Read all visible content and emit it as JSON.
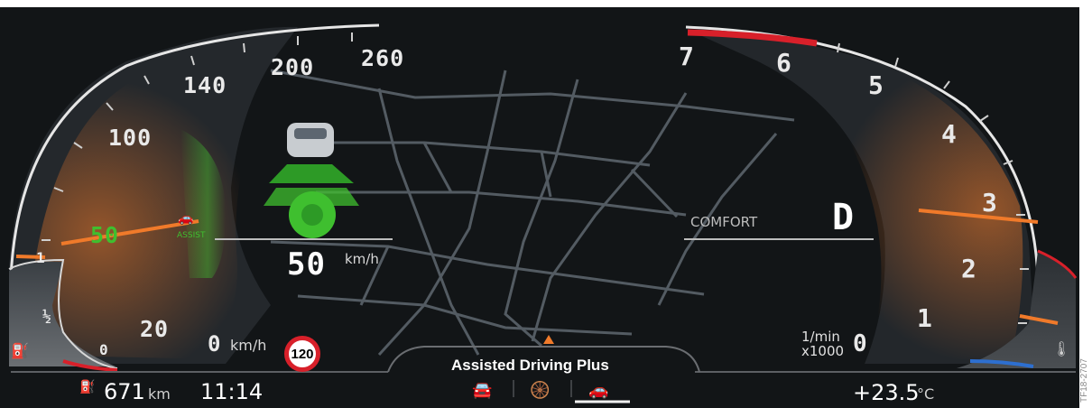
{
  "speedometer": {
    "scale_labels": [
      "20",
      "100",
      "140",
      "200",
      "260"
    ],
    "highlighted_speed": "50",
    "zero_label": "0",
    "zero_unit": "km/h",
    "current_speed_value": "50",
    "current_speed_unit": "km/h",
    "assist_label": "ASSIST"
  },
  "fuel_gauge": {
    "labels": [
      "1",
      "½",
      "0"
    ],
    "range_value": "671",
    "range_unit": "km"
  },
  "clock": "11:14",
  "speed_limit_sign": "120",
  "tachometer": {
    "scale_labels": [
      "1",
      "2",
      "3",
      "4",
      "5",
      "6",
      "7"
    ],
    "zero_label": "0",
    "unit_top": "1/min",
    "unit_bottom": "x1000"
  },
  "drive": {
    "mode": "COMFORT",
    "gear": "D"
  },
  "temperature": {
    "value": "+23.5",
    "unit": "°C"
  },
  "assist_menu": {
    "title": "Assisted Driving Plus",
    "icons": [
      "cruise-control-icon",
      "steering-assist-icon",
      "assisted-driving-icon"
    ],
    "active_index": 2
  },
  "image_credit": "TF18-2707",
  "colors": {
    "accent_orange": "#f07a2a",
    "assist_green": "#3fbf2f",
    "redline": "#d8202a",
    "panel_bg": "#111417"
  }
}
